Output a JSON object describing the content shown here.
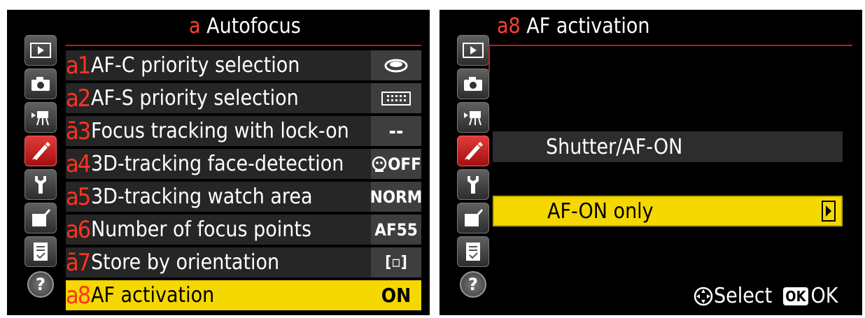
{
  "left": {
    "title_prefix": "a",
    "title": "Autofocus",
    "items": [
      {
        "code": "a1",
        "label": "AF-C priority selection",
        "value_icon": "release-icon"
      },
      {
        "code": "a2",
        "label": "AF-S priority selection",
        "value_icon": "focus-area-icon"
      },
      {
        "code": "ā3",
        "label": "Focus tracking with lock-on",
        "value": "--"
      },
      {
        "code": "a4",
        "label": "3D-tracking face-detection",
        "value": "OFF",
        "value_icon": "face-icon"
      },
      {
        "code": "a5",
        "label": "3D-tracking watch area",
        "value": "NORM"
      },
      {
        "code": "a6",
        "label": "Number of focus points",
        "value": "AF55"
      },
      {
        "code": "ā7",
        "label": "Store by orientation",
        "value": "[▫]"
      },
      {
        "code": "a8",
        "label": "AF activation",
        "value": "ON",
        "selected": true
      }
    ]
  },
  "right": {
    "title_prefix": "a8",
    "title": "AF activation",
    "options": [
      {
        "label": "Shutter/AF-ON"
      },
      {
        "label": "AF-ON only",
        "selected": true
      }
    ],
    "footer": {
      "select": "Select",
      "ok_badge": "OK",
      "ok": "OK"
    }
  },
  "tabs": [
    "playback-icon",
    "camera-icon",
    "movie-icon",
    "pencil-icon",
    "wrench-icon",
    "retouch-icon",
    "my-menu-icon",
    "help-icon"
  ],
  "colors": {
    "accent_yellow": "#f4d800",
    "code_red": "#ff3322",
    "active_tab": "#c41e1e"
  }
}
